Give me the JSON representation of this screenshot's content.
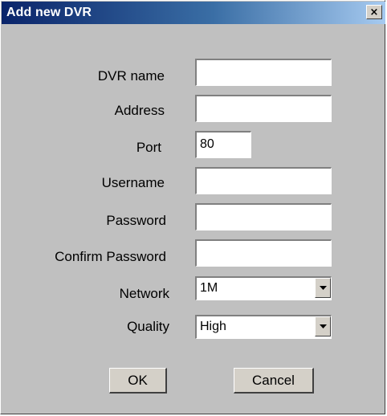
{
  "dialog": {
    "title": "Add new DVR",
    "close_glyph": "×"
  },
  "form": {
    "dvr_name": {
      "label": "DVR name",
      "value": ""
    },
    "address": {
      "label": "Address",
      "value": ""
    },
    "port": {
      "label": "Port",
      "value": "80"
    },
    "username": {
      "label": "Username",
      "value": ""
    },
    "password": {
      "label": "Password",
      "value": ""
    },
    "confirm_password": {
      "label": "Confirm Password",
      "value": ""
    },
    "network": {
      "label": "Network",
      "selected": "1M"
    },
    "quality": {
      "label": "Quality",
      "selected": "High"
    }
  },
  "buttons": {
    "ok_label": "OK",
    "cancel_label": "Cancel"
  },
  "icons": {
    "close": "close-icon",
    "dropdown": "chevron-down-icon"
  }
}
